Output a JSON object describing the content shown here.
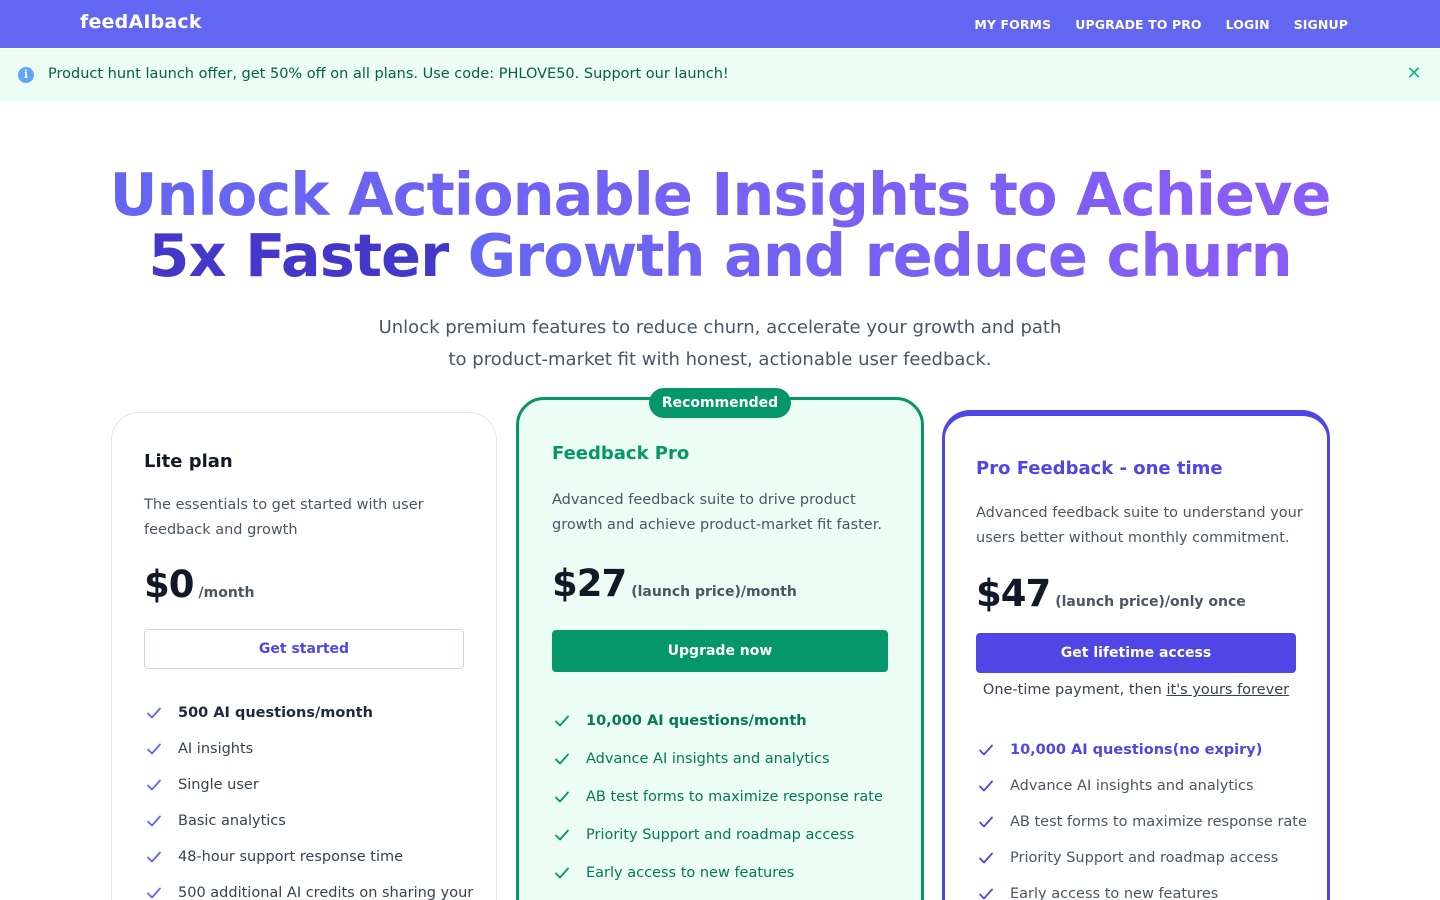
{
  "nav": {
    "brand": "feedAIback",
    "links": [
      "MY FORMS",
      "UPGRADE TO PRO",
      "LOGIN",
      "SIGNUP"
    ]
  },
  "banner": {
    "text": "Product hunt launch offer, get 50% off on all plans. Use code: PHLOVE50. Support our launch!"
  },
  "hero": {
    "line1": "Unlock Actionable Insights to Achieve",
    "line2_accent": "5x Faster",
    "line2_rest": " Growth and reduce churn",
    "subtitle": "Unlock premium features to reduce churn, accelerate your growth and path to product-market fit with honest, actionable user feedback."
  },
  "plans": {
    "lite": {
      "name": "Lite plan",
      "description": "The essentials to get started with user feedback and growth",
      "price": "$0",
      "unit": "/month",
      "cta": "Get started",
      "features": [
        "500 AI questions/month",
        "AI insights",
        "Single user",
        "Basic analytics",
        "48-hour support response time",
        "500 additional AI credits on sharing your"
      ]
    },
    "pro": {
      "badge": "Recommended",
      "name": "Feedback Pro",
      "description": "Advanced feedback suite to drive product growth and achieve product-market fit faster.",
      "price": "$27",
      "unit": "(launch price)/month",
      "cta": "Upgrade now",
      "features": [
        "10,000 AI questions/month",
        "Advance AI insights and analytics",
        "AB test forms to maximize response rate",
        "Priority Support and roadmap access",
        "Early access to new features"
      ]
    },
    "lifetime": {
      "name": "Pro Feedback - one time",
      "description": "Advanced feedback suite to understand your users better without monthly commitment.",
      "price": "$47",
      "unit": "(launch price)/only once",
      "cta": "Get lifetime access",
      "note_prefix": "One-time payment, then ",
      "note_link": "it's yours forever",
      "features": [
        "10,000 AI questions(no expiry)",
        "Advance AI insights and analytics",
        "AB test forms to maximize response rate",
        "Priority Support and roadmap access",
        "Early access to new features"
      ]
    }
  },
  "colors": {
    "nav_bg": "#6366f1",
    "banner_bg": "#ecfdf5",
    "pro_green": "#059669",
    "indigo": "#4f46e5"
  }
}
